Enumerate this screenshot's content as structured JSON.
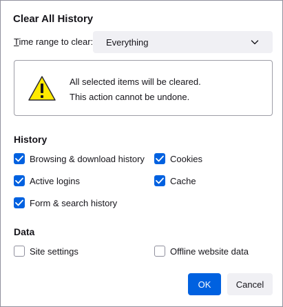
{
  "dialog": {
    "title": "Clear All History",
    "time_range": {
      "label_access": "T",
      "label_rest": "ime range to clear:",
      "selected": "Everything"
    },
    "warning": {
      "line1": "All selected items will be cleared.",
      "line2": "This action cannot be undone."
    },
    "history": {
      "heading": "History",
      "items": [
        {
          "label": "Browsing & download history",
          "checked": true
        },
        {
          "label": "Cookies",
          "checked": true
        },
        {
          "label": "Active logins",
          "checked": true
        },
        {
          "label": "Cache",
          "checked": true
        },
        {
          "label": "Form & search history",
          "checked": true
        }
      ]
    },
    "data": {
      "heading": "Data",
      "items": [
        {
          "label": "Site settings",
          "checked": false
        },
        {
          "label": "Offline website data",
          "checked": false
        }
      ]
    },
    "buttons": {
      "ok": "OK",
      "cancel": "Cancel"
    }
  },
  "colors": {
    "accent": "#0061e0",
    "warning": "#ffe900"
  }
}
